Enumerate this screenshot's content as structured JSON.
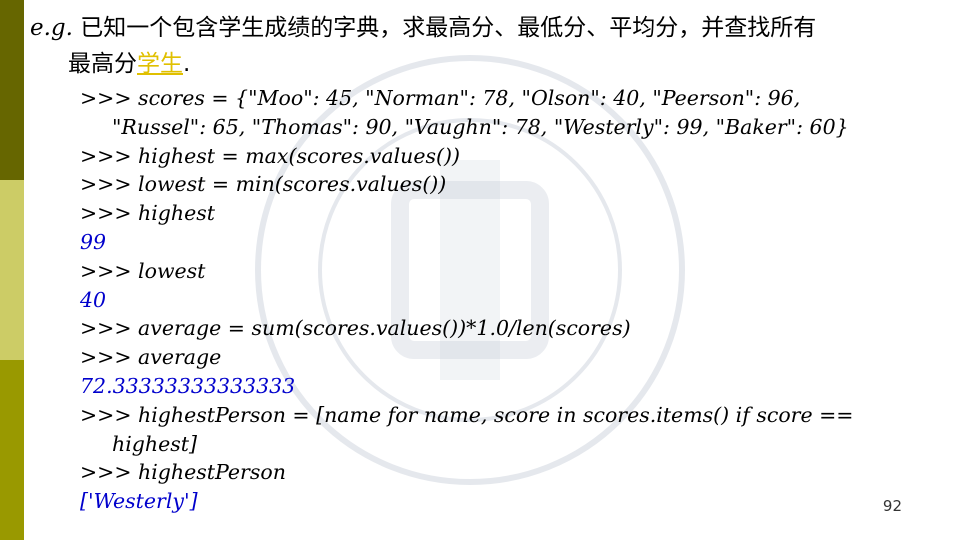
{
  "slide": {
    "title_prefix": "e.g.",
    "title_text": " 已知一个包含学生成绩的字典，求最高分、最低分、平均分，并查找所有",
    "title_line2_a": "最高分",
    "title_line2_hl": "学生",
    "title_line2_b": ".",
    "page_number": "92"
  },
  "code": {
    "l1": ">>> scores = {\"Moo\": 45, \"Norman\": 78, \"Olson\": 40, \"Peerson\": 96,",
    "l1c": "\"Russel\": 65, \"Thomas\": 90, \"Vaughn\": 78, \"Westerly\": 99, \"Baker\": 60}",
    "l2": ">>> highest = max(scores.values())",
    "l3": ">>> lowest = min(scores.values())",
    "l4": ">>> highest",
    "o4": "99",
    "l5": ">>> lowest",
    "o5": "40",
    "l6": ">>> average = sum(scores.values())*1.0/len(scores)",
    "l7": ">>> average",
    "o7": "72.33333333333333",
    "l8": ">>> highestPerson = [name for name, score in scores.items() if score ==",
    "l8c": "highest]",
    "l9": ">>> highestPerson",
    "o9": "['Westerly']"
  },
  "colors": {
    "stripe_top": "#666600",
    "stripe_mid": "#cccc66",
    "stripe_bottom": "#999900",
    "output_text": "#0000cc",
    "highlight": "#e0c000"
  }
}
